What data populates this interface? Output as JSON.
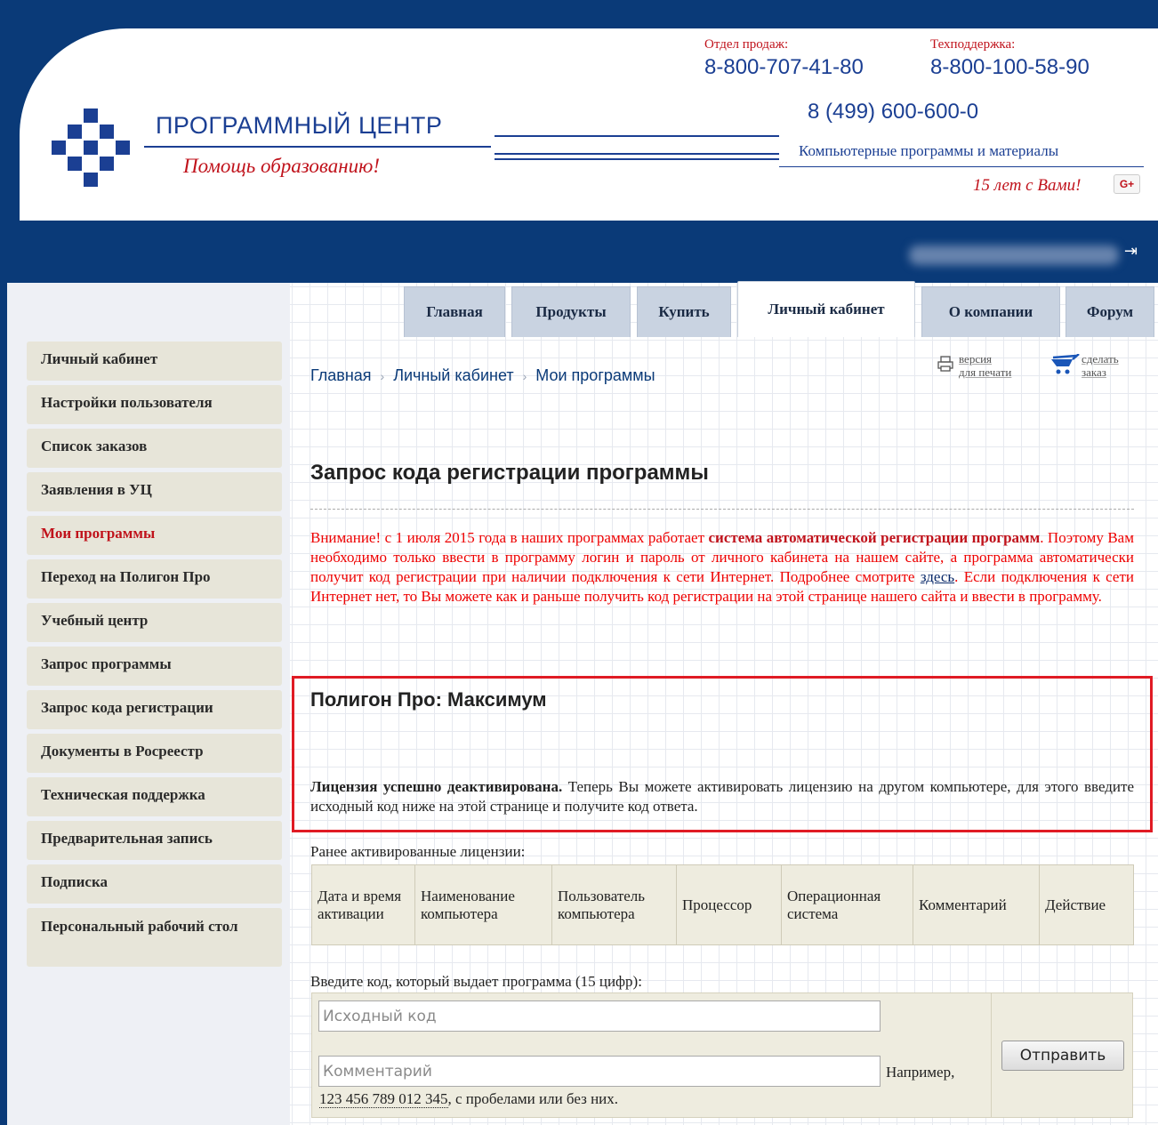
{
  "header": {
    "brand_name": "ПРОГРАММНЫЙ ЦЕНТР",
    "brand_slogan": "Помощь образованию!",
    "sales_label": "Отдел продаж:",
    "sales_phone": "8-800-707-41-80",
    "support_label": "Техподдержка:",
    "support_phone": "8-800-100-58-90",
    "main_phone": "8 (499) 600-600-0",
    "tagline": "Компьютерные программы и материалы",
    "years": "15 лет с Вами!",
    "gplus": "G+"
  },
  "tabs": [
    {
      "label": "Главная"
    },
    {
      "label": "Продукты"
    },
    {
      "label": "Купить"
    },
    {
      "label": "Личный кабинет",
      "active": true
    },
    {
      "label": "О компании"
    },
    {
      "label": "Форум"
    }
  ],
  "sidebar": {
    "items": [
      {
        "label": "Личный кабинет"
      },
      {
        "label": "Настройки пользователя"
      },
      {
        "label": "Список заказов"
      },
      {
        "label": "Заявления в УЦ"
      },
      {
        "label": "Мои программы",
        "active": true
      },
      {
        "label": "Переход на Полигон Про"
      },
      {
        "label": "Учебный центр"
      },
      {
        "label": "Запрос программы"
      },
      {
        "label": "Запрос кода регистрации"
      },
      {
        "label": "Документы в Росреестр"
      },
      {
        "label": "Техническая поддержка"
      },
      {
        "label": "Предварительная запись"
      },
      {
        "label": "Подписка"
      },
      {
        "label": "Персональный рабочий стол"
      }
    ]
  },
  "breadcrumb": {
    "items": [
      "Главная",
      "Личный кабинет",
      "Мои программы"
    ],
    "separator": "›"
  },
  "tools": {
    "print_line1": "версия",
    "print_line2": "для печати",
    "order_line1": "сделать",
    "order_line2": "заказ"
  },
  "main": {
    "title": "Запрос кода регистрации программы",
    "notice": {
      "part1": "Внимание! с 1 июля 2015 года в наших программах работает ",
      "bold": "система автоматической регистрации программ",
      "part2": ". Поэтому Вам необходимо только ввести в программу логин и пароль от личного кабинета на нашем сайте, а программа автоматически получит код регистрации при наличии подключения к сети Интернет. Подробнее смотрите ",
      "link": "здесь",
      "part3": ". Если подключения к сети Интернет нет, то Вы можете как и раньше получить код регистрации на этой странице нашего сайта и ввести в программу."
    },
    "product_name": "Полигон Про: Максимум",
    "license_bold": "Лицензия успешно деактивирована.",
    "license_text": " Теперь Вы можете активировать лицензию на другом компьютере, для этого введите исходный код ниже на этой странице и получите код ответа.",
    "prev_label": "Ранее активированные лицензии:",
    "table_headers": [
      "Дата и время активации",
      "Наименование компьютера",
      "Пользователь компьютера",
      "Процессор",
      "Операционная система",
      "Комментарий",
      "Действие"
    ],
    "code_label": "Введите код, который выдает программа (15 цифр):",
    "source_placeholder": "Исходный код",
    "comment_placeholder": "Комментарий",
    "example_prefix": "Например,",
    "example_code": "123 456 789 012 345",
    "example_suffix": ", с пробелами или без них.",
    "submit_label": "Отправить"
  },
  "colors": {
    "brand_blue": "#1b3f93",
    "dark_bar": "#0a3a78",
    "accent_red": "#c0121b",
    "highlight_red": "#e01b24"
  }
}
